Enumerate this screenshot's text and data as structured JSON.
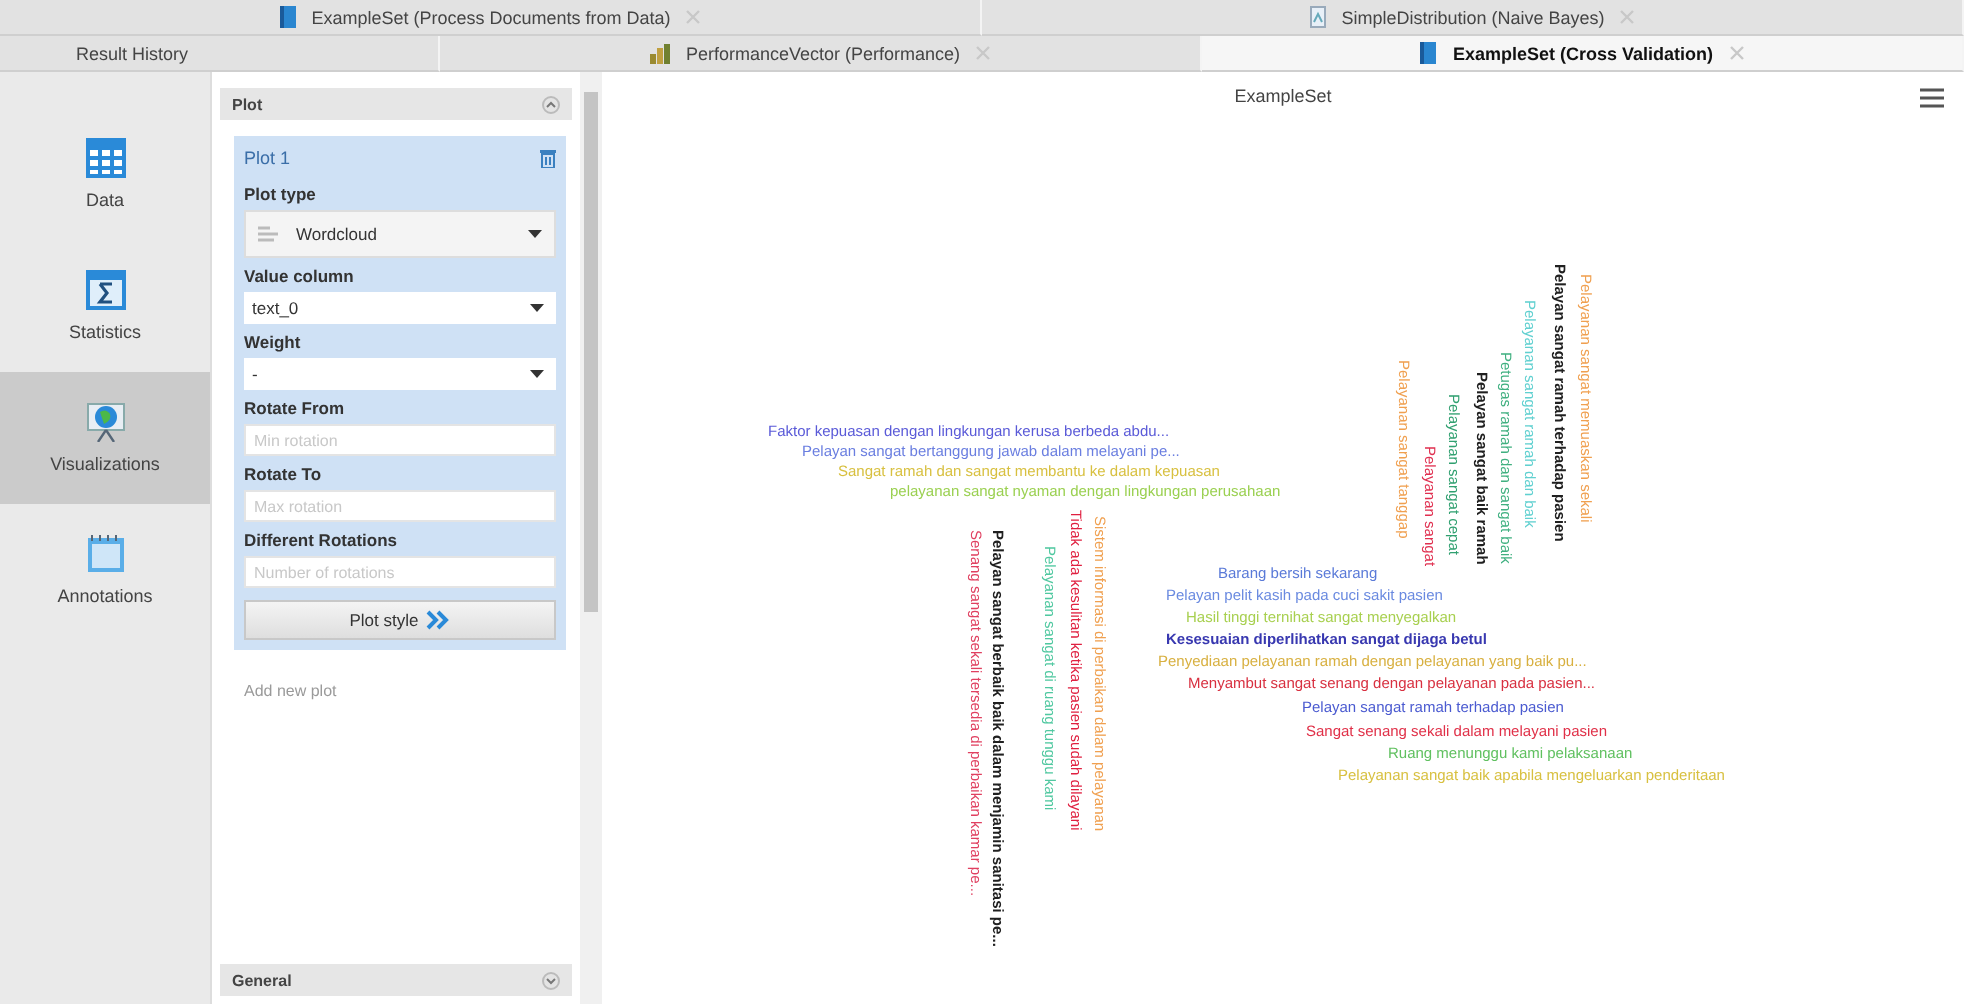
{
  "tab_rows": [
    [
      {
        "label": "ExampleSet (Process Documents from Data)",
        "selected": false
      },
      {
        "label": "SimpleDistribution (Naive Bayes)",
        "selected": false
      }
    ],
    [
      {
        "label": "Result History",
        "selected": false
      },
      {
        "label": "PerformanceVector (Performance)",
        "selected": false
      },
      {
        "label": "ExampleSet (Cross Validation)",
        "selected": true
      }
    ]
  ],
  "sidebar": {
    "items": [
      {
        "label": "Data",
        "selected": false
      },
      {
        "label": "Statistics",
        "selected": false
      },
      {
        "label": "Visualizations",
        "selected": true
      },
      {
        "label": "Annotations",
        "selected": false
      }
    ]
  },
  "settings": {
    "sections": [
      {
        "title": "Plot",
        "expanded": true
      },
      {
        "title": "General",
        "expanded": false
      }
    ],
    "plot": {
      "title": "Plot 1",
      "fields": [
        {
          "label": "Plot type",
          "kind": "select",
          "value": "Wordcloud"
        },
        {
          "label": "Value column",
          "kind": "select",
          "value": "text_0"
        },
        {
          "label": "Weight",
          "kind": "select",
          "value": "-"
        },
        {
          "label": "Rotate From",
          "kind": "input",
          "placeholder": "Min rotation"
        },
        {
          "label": "Rotate To",
          "kind": "input",
          "placeholder": "Max rotation"
        },
        {
          "label": "Different Rotations",
          "kind": "input",
          "placeholder": "Number of rotations"
        }
      ],
      "style_button": "Plot style"
    },
    "add_plot": {
      "label": "Add new plot",
      "disabled": true
    }
  },
  "chart": {
    "title": "ExampleSet",
    "words": [
      {
        "text": "Faktor kepuasan dengan lingkungan kerusa berbeda abdu...",
        "color": "#5a5ad8",
        "bold": false,
        "vertical": false
      },
      {
        "text": "Pelayan sangat bertanggung jawab dalam melayani pe...",
        "color": "#6a7ee0",
        "bold": false,
        "vertical": false
      },
      {
        "text": "Sangat ramah dan sangat membantu ke dalam kepuasan",
        "color": "#d8c040",
        "bold": false,
        "vertical": false
      },
      {
        "text": "pelayanan sangat nyaman dengan lingkungan perusahaan",
        "color": "#9ad050",
        "bold": false,
        "vertical": false
      },
      {
        "text": "Barang bersih sekarang",
        "color": "#5a7ad8",
        "bold": false,
        "vertical": false
      },
      {
        "text": "Pelayan pelit kasih pada cuci sakit pasien",
        "color": "#6a8ae0",
        "bold": false,
        "vertical": false
      },
      {
        "text": "Hasil tinggi ternihat sangat menyegalkan",
        "color": "#a8d050",
        "bold": false,
        "vertical": false
      },
      {
        "text": "Kesesuaian diperlihatkan sangat dijaga betul",
        "color": "#3838b0",
        "bold": true,
        "vertical": false
      },
      {
        "text": "Penyediaan pelayanan ramah dengan pelayanan yang baik pu...",
        "color": "#d8b040",
        "bold": false,
        "vertical": false
      },
      {
        "text": "Menyambut sangat senang dengan pelayanan pada pasien...",
        "color": "#d83040",
        "bold": false,
        "vertical": false
      },
      {
        "text": "Pelayan sangat ramah terhadap pasien",
        "color": "#4a5ad0",
        "bold": false,
        "vertical": false
      },
      {
        "text": "Sangat senang sekali dalam melayani pasien",
        "color": "#e03048",
        "bold": false,
        "vertical": false
      },
      {
        "text": "Ruang menunggu kami pelaksanaan",
        "color": "#60c060",
        "bold": false,
        "vertical": false
      },
      {
        "text": "Pelayanan sangat baik apabila mengeluarkan penderitaan",
        "color": "#d8c040",
        "bold": false,
        "vertical": false
      },
      {
        "text": "Senang sangat sekali tersedia di perbaikan kamar pe...",
        "color": "#e04060",
        "bold": false,
        "vertical": true
      },
      {
        "text": "Pelayan sangat berbaik baik dalam menjamin sanitasi pe...",
        "color": "#202020",
        "bold": true,
        "vertical": true
      },
      {
        "text": "Pelayanan sangat di ruang tunggu kami",
        "color": "#50c8a0",
        "bold": false,
        "vertical": true
      },
      {
        "text": "Tidak ada kesulitan ketika pasien sudah dilayani",
        "color": "#e02040",
        "bold": false,
        "vertical": true
      },
      {
        "text": "Sistem informasi di perbaikan dalam pelayanan",
        "color": "#f0a050",
        "bold": false,
        "vertical": true
      },
      {
        "text": "Pelayanan sangat tanggap",
        "color": "#f0a050",
        "bold": false,
        "vertical": true
      },
      {
        "text": "Pelayanan sangat",
        "color": "#e03050",
        "bold": false,
        "vertical": true
      },
      {
        "text": "Pelayanan sangat cepat",
        "color": "#30a070",
        "bold": false,
        "vertical": true
      },
      {
        "text": "Pelayan sangat baik ramah",
        "color": "#202020",
        "bold": true,
        "vertical": true
      },
      {
        "text": "Petugas ramah dan sangat baik",
        "color": "#40b080",
        "bold": false,
        "vertical": true
      },
      {
        "text": "Pelayanan sangat ramah dan baik",
        "color": "#60d0d0",
        "bold": false,
        "vertical": true
      },
      {
        "text": "Pelayan sangat ramah terhadap pasien",
        "color": "#202020",
        "bold": true,
        "vertical": true
      },
      {
        "text": "Pelayanan sangat memuaskan sekali",
        "color": "#f0a050",
        "bold": false,
        "vertical": true
      }
    ]
  }
}
